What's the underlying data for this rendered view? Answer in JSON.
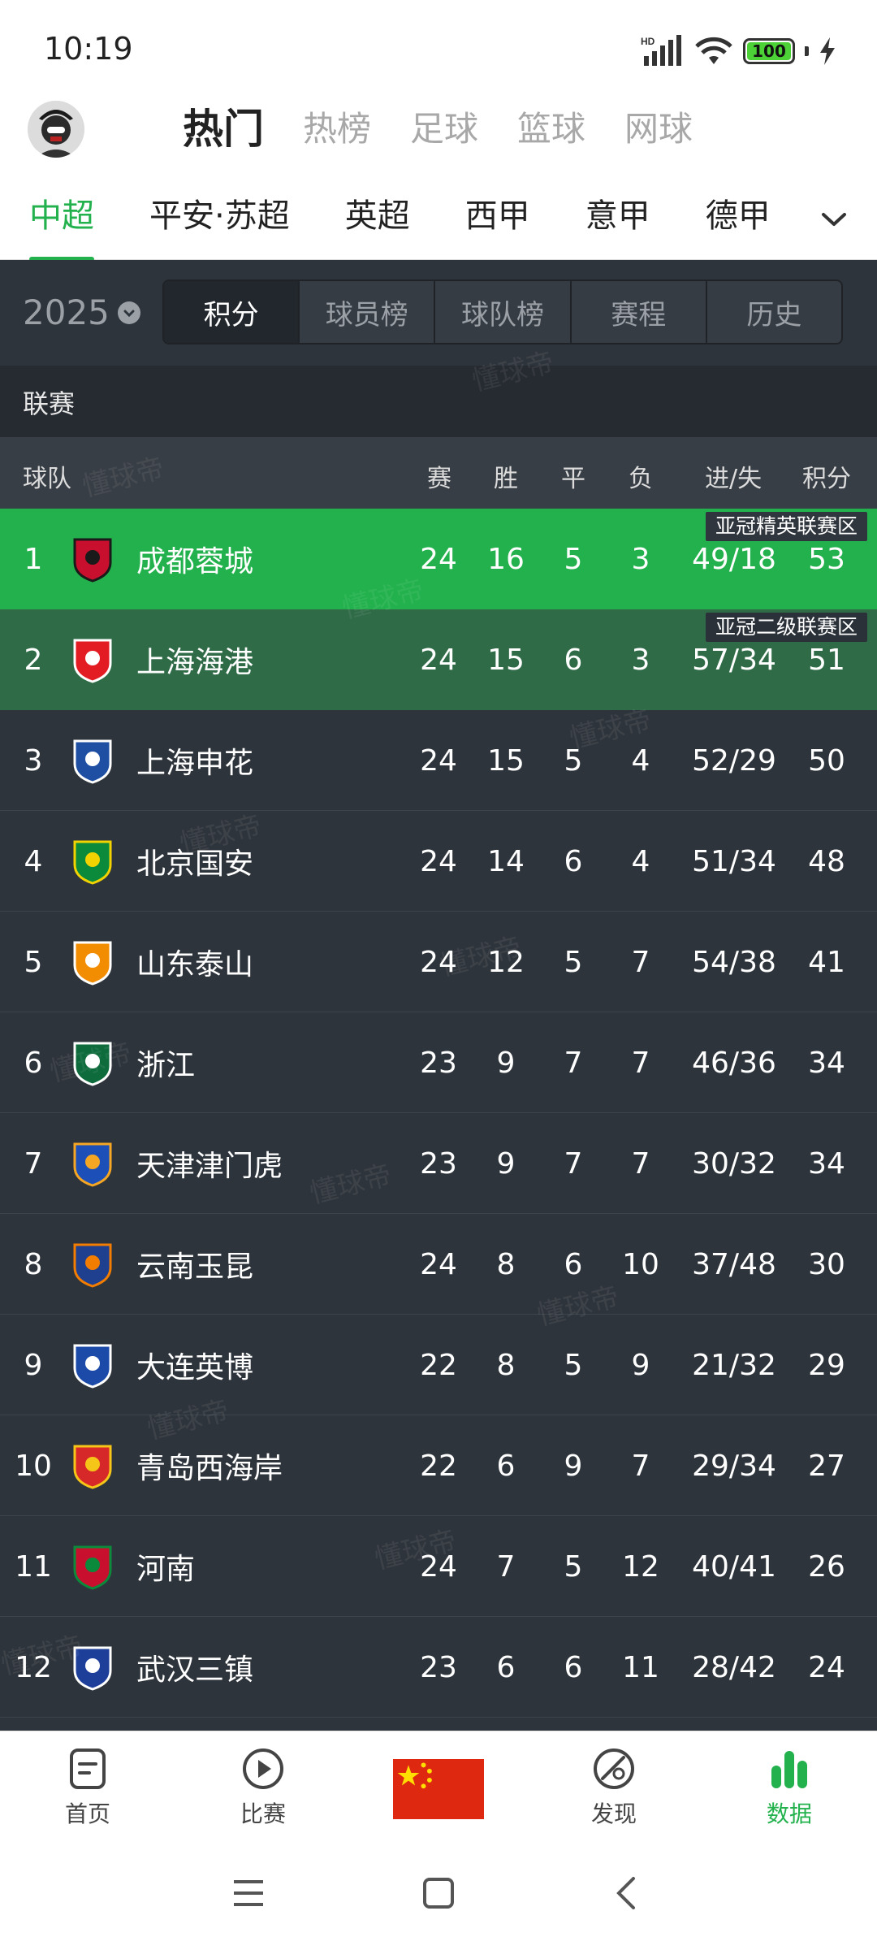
{
  "status": {
    "time": "10:19",
    "battery": "100",
    "battery_level": 1.0,
    "network": "HD"
  },
  "top_tabs": [
    "热门",
    "热榜",
    "足球",
    "篮球",
    "网球"
  ],
  "league_tabs": [
    "中超",
    "平安·苏超",
    "英超",
    "西甲",
    "意甲",
    "德甲"
  ],
  "season": {
    "year": "2025"
  },
  "segments": [
    "积分",
    "球员榜",
    "球队榜",
    "赛程",
    "历史"
  ],
  "section_title": "联赛",
  "table": {
    "headers": {
      "team": "球队",
      "played": "赛",
      "win": "胜",
      "draw": "平",
      "loss": "负",
      "goals": "进/失",
      "points": "积分"
    },
    "rows": [
      {
        "rank": "1",
        "team": "成都蓉城",
        "played": "24",
        "win": "16",
        "draw": "5",
        "loss": "3",
        "goals": "49/18",
        "points": "53",
        "tag": "亚冠精英联赛区",
        "logo_colors": [
          "#c8102e",
          "#1a1a1a"
        ]
      },
      {
        "rank": "2",
        "team": "上海海港",
        "played": "24",
        "win": "15",
        "draw": "6",
        "loss": "3",
        "goals": "57/34",
        "points": "51",
        "tag": "亚冠二级联赛区",
        "logo_colors": [
          "#e31b23",
          "#ffffff"
        ]
      },
      {
        "rank": "3",
        "team": "上海申花",
        "played": "24",
        "win": "15",
        "draw": "5",
        "loss": "4",
        "goals": "52/29",
        "points": "50",
        "tag": "",
        "logo_colors": [
          "#1e4fa3",
          "#ffffff"
        ]
      },
      {
        "rank": "4",
        "team": "北京国安",
        "played": "24",
        "win": "14",
        "draw": "6",
        "loss": "4",
        "goals": "51/34",
        "points": "48",
        "tag": "",
        "logo_colors": [
          "#0a8a3a",
          "#f2d200"
        ]
      },
      {
        "rank": "5",
        "team": "山东泰山",
        "played": "24",
        "win": "12",
        "draw": "5",
        "loss": "7",
        "goals": "54/38",
        "points": "41",
        "tag": "",
        "logo_colors": [
          "#f28c00",
          "#ffffff"
        ]
      },
      {
        "rank": "6",
        "team": "浙江",
        "played": "23",
        "win": "9",
        "draw": "7",
        "loss": "7",
        "goals": "46/36",
        "points": "34",
        "tag": "",
        "logo_colors": [
          "#0d6b3c",
          "#ffffff"
        ]
      },
      {
        "rank": "7",
        "team": "天津津门虎",
        "played": "23",
        "win": "9",
        "draw": "7",
        "loss": "7",
        "goals": "30/32",
        "points": "34",
        "tag": "",
        "logo_colors": [
          "#1c4fb8",
          "#f5a623"
        ]
      },
      {
        "rank": "8",
        "team": "云南玉昆",
        "played": "24",
        "win": "8",
        "draw": "6",
        "loss": "10",
        "goals": "37/48",
        "points": "30",
        "tag": "",
        "logo_colors": [
          "#1f3f8f",
          "#f27d00"
        ]
      },
      {
        "rank": "9",
        "team": "大连英博",
        "played": "22",
        "win": "8",
        "draw": "5",
        "loss": "9",
        "goals": "21/32",
        "points": "29",
        "tag": "",
        "logo_colors": [
          "#1b4aa8",
          "#ffffff"
        ]
      },
      {
        "rank": "10",
        "team": "青岛西海岸",
        "played": "22",
        "win": "6",
        "draw": "9",
        "loss": "7",
        "goals": "29/34",
        "points": "27",
        "tag": "",
        "logo_colors": [
          "#d62828",
          "#f5c518"
        ]
      },
      {
        "rank": "11",
        "team": "河南",
        "played": "24",
        "win": "7",
        "draw": "5",
        "loss": "12",
        "goals": "40/41",
        "points": "26",
        "tag": "",
        "logo_colors": [
          "#c8102e",
          "#0a8a3a"
        ]
      },
      {
        "rank": "12",
        "team": "武汉三镇",
        "played": "23",
        "win": "6",
        "draw": "6",
        "loss": "11",
        "goals": "28/42",
        "points": "24",
        "tag": "",
        "logo_colors": [
          "#1d3f9a",
          "#ffffff"
        ]
      }
    ]
  },
  "watermark": "懂球帝",
  "bottom_nav": [
    {
      "label": "首页",
      "icon": "home-doc-icon"
    },
    {
      "label": "比赛",
      "icon": "play-circle-icon"
    },
    {
      "label": "",
      "icon": "china-flag-icon"
    },
    {
      "label": "发现",
      "icon": "discover-ball-icon"
    },
    {
      "label": "数据",
      "icon": "bar-chart-icon"
    }
  ],
  "colors": {
    "accent": "#22b14c",
    "bg_dark": "#2e343b",
    "acl_elite": "#22b14c",
    "acl_two": "#2f6b47"
  }
}
